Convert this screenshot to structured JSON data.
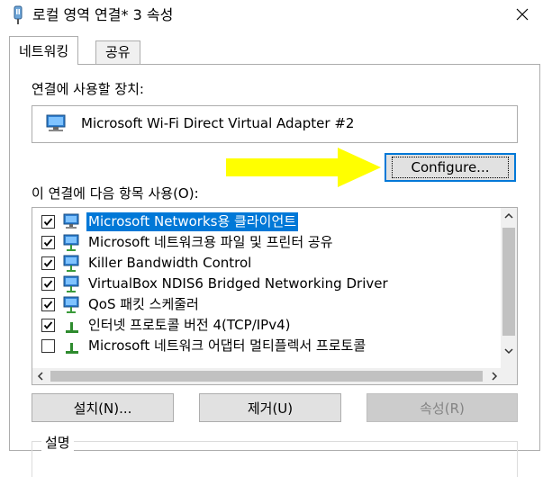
{
  "window": {
    "title": "로컬 영역 연결* 3 속성",
    "close_icon": "close-icon"
  },
  "tabs": [
    {
      "label": "네트워킹",
      "active": true
    },
    {
      "label": "공유",
      "active": false
    }
  ],
  "connect_using": {
    "label": "연결에 사용할 장치:",
    "device_name": "Microsoft Wi-Fi Direct Virtual Adapter #2",
    "configure_label": "Configure..."
  },
  "items_section": {
    "label": "이 연결에 다음 항목 사용(O):",
    "items": [
      {
        "label": "Microsoft Networks용 클라이언트",
        "checked": true,
        "icon": "network-client-icon",
        "selected": true
      },
      {
        "label": "Microsoft 네트워크용 파일 및 프린터 공유",
        "checked": true,
        "icon": "network-service-icon",
        "selected": false
      },
      {
        "label": "Killer Bandwidth Control",
        "checked": true,
        "icon": "network-service-icon",
        "selected": false
      },
      {
        "label": "VirtualBox NDIS6 Bridged Networking Driver",
        "checked": true,
        "icon": "network-service-icon",
        "selected": false
      },
      {
        "label": "QoS 패킷 스케줄러",
        "checked": true,
        "icon": "network-service-icon",
        "selected": false
      },
      {
        "label": "인터넷 프로토콜 버전 4(TCP/IPv4)",
        "checked": true,
        "icon": "protocol-icon",
        "selected": false
      },
      {
        "label": "Microsoft 네트워크 어댑터 멀티플렉서 프로토콜",
        "checked": false,
        "icon": "protocol-icon",
        "selected": false
      }
    ]
  },
  "buttons": {
    "install": "설치(N)...",
    "uninstall": "제거(U)",
    "properties": "속성(R)"
  },
  "description": {
    "label": "설명"
  },
  "colors": {
    "selection": "#0078d7",
    "arrow": "#ffff00",
    "focus_border": "#0078d7"
  }
}
